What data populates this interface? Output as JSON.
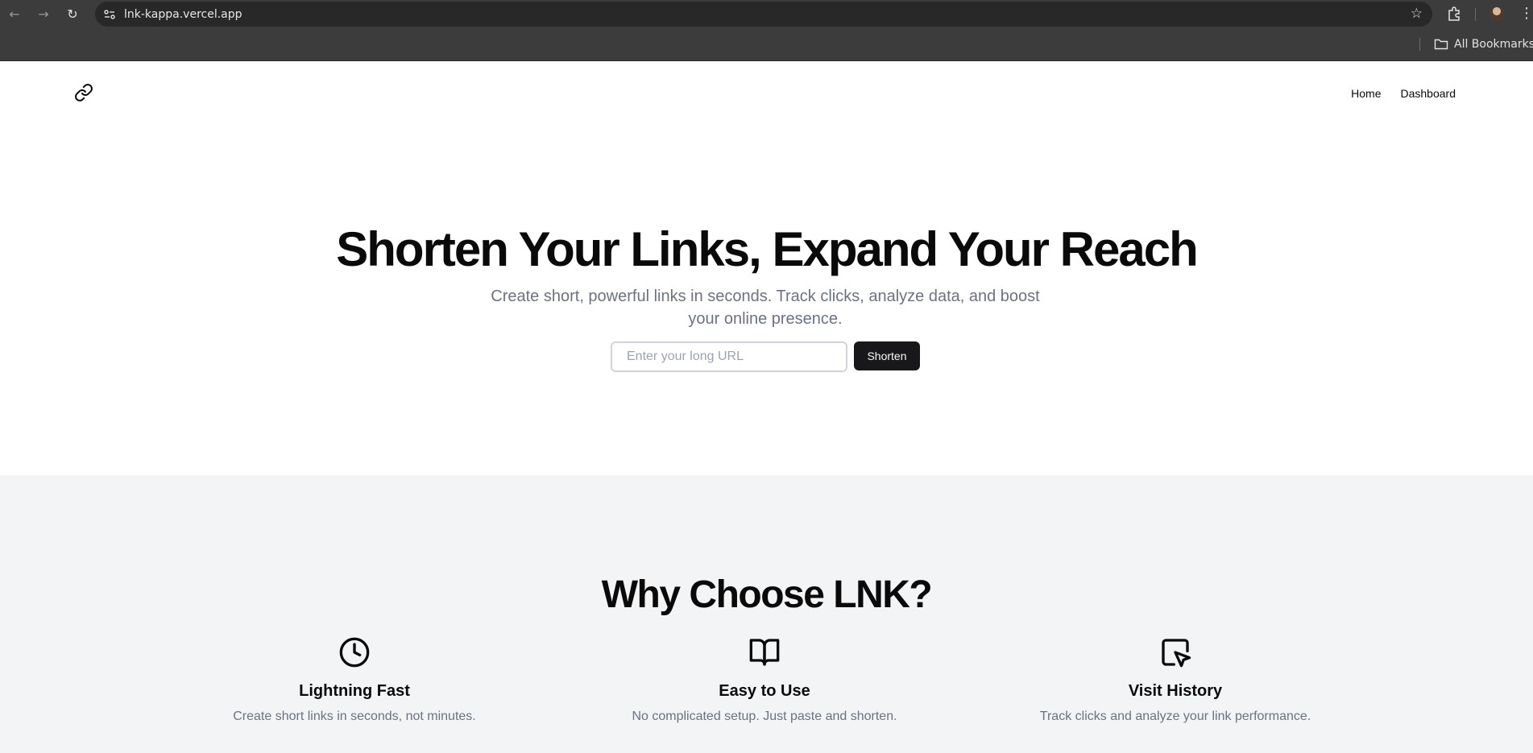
{
  "browser": {
    "url": "lnk-kappa.vercel.app",
    "bookmarks_label": "All Bookmarks"
  },
  "header": {
    "nav": [
      "Home",
      "Dashboard"
    ]
  },
  "hero": {
    "title": "Shorten Your Links, Expand Your Reach",
    "subtitle": "Create short, powerful links in seconds. Track clicks, analyze data, and boost your online presence.",
    "input_placeholder": "Enter your long URL",
    "button_label": "Shorten"
  },
  "features": {
    "title": "Why Choose LNK?",
    "items": [
      {
        "icon": "clock-icon",
        "title": "Lightning Fast",
        "description": "Create short links in seconds, not minutes."
      },
      {
        "icon": "book-open-icon",
        "title": "Easy to Use",
        "description": "No complicated setup. Just paste and shorten."
      },
      {
        "icon": "cursor-click-icon",
        "title": "Visit History",
        "description": "Track clicks and analyze your link performance."
      }
    ]
  }
}
